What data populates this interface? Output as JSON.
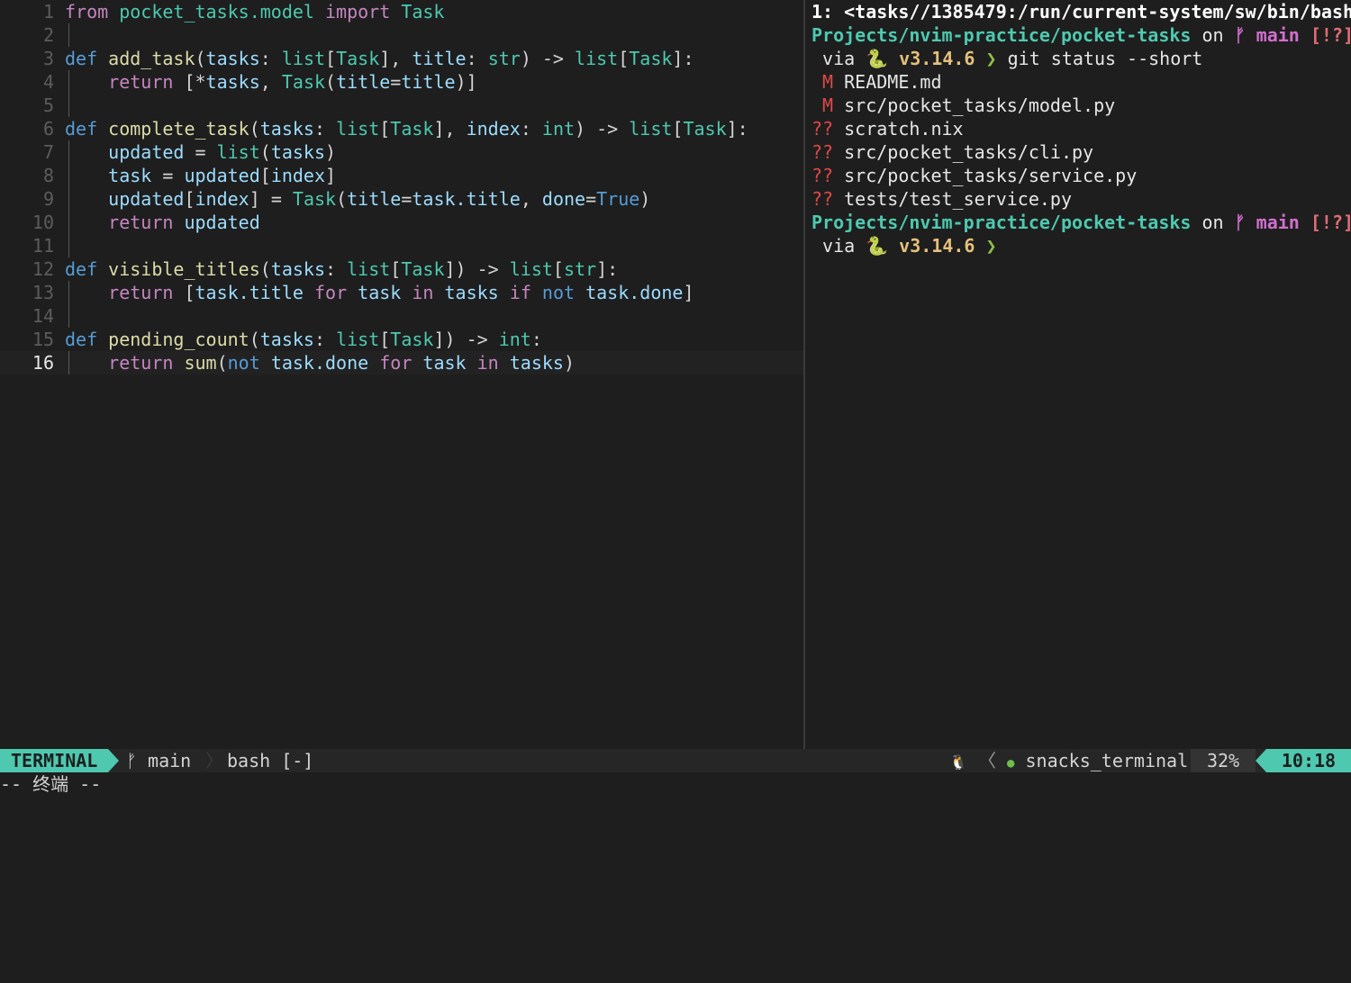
{
  "editor": {
    "lines": [
      {
        "num": "1",
        "tokens": [
          [
            "kw",
            "from"
          ],
          [
            "op",
            " "
          ],
          [
            "mod",
            "pocket_tasks.model"
          ],
          [
            "op",
            " "
          ],
          [
            "kw",
            "import"
          ],
          [
            "op",
            " "
          ],
          [
            "type",
            "Task"
          ]
        ]
      },
      {
        "num": "2",
        "tokens": []
      },
      {
        "num": "3",
        "tokens": [
          [
            "def",
            "def"
          ],
          [
            "op",
            " "
          ],
          [
            "fn",
            "add_task"
          ],
          [
            "punct",
            "("
          ],
          [
            "param",
            "tasks"
          ],
          [
            "punct",
            ": "
          ],
          [
            "type",
            "list"
          ],
          [
            "punct",
            "["
          ],
          [
            "type",
            "Task"
          ],
          [
            "punct",
            "], "
          ],
          [
            "param",
            "title"
          ],
          [
            "punct",
            ": "
          ],
          [
            "type",
            "str"
          ],
          [
            "punct",
            ") -> "
          ],
          [
            "type",
            "list"
          ],
          [
            "punct",
            "["
          ],
          [
            "type",
            "Task"
          ],
          [
            "punct",
            "]:"
          ]
        ]
      },
      {
        "num": "4",
        "tokens": [
          [
            "op",
            "    "
          ],
          [
            "kw",
            "return"
          ],
          [
            "punct",
            " [*"
          ],
          [
            "param",
            "tasks"
          ],
          [
            "punct",
            ", "
          ],
          [
            "type",
            "Task"
          ],
          [
            "punct",
            "("
          ],
          [
            "param",
            "title"
          ],
          [
            "punct",
            "="
          ],
          [
            "param",
            "title"
          ],
          [
            "punct",
            ")]"
          ]
        ]
      },
      {
        "num": "5",
        "tokens": []
      },
      {
        "num": "6",
        "tokens": [
          [
            "def",
            "def"
          ],
          [
            "op",
            " "
          ],
          [
            "fn",
            "complete_task"
          ],
          [
            "punct",
            "("
          ],
          [
            "param",
            "tasks"
          ],
          [
            "punct",
            ": "
          ],
          [
            "type",
            "list"
          ],
          [
            "punct",
            "["
          ],
          [
            "type",
            "Task"
          ],
          [
            "punct",
            "], "
          ],
          [
            "param",
            "index"
          ],
          [
            "punct",
            ": "
          ],
          [
            "type",
            "int"
          ],
          [
            "punct",
            ") -> "
          ],
          [
            "type",
            "list"
          ],
          [
            "punct",
            "["
          ],
          [
            "type",
            "Task"
          ],
          [
            "punct",
            "]:"
          ]
        ]
      },
      {
        "num": "7",
        "tokens": [
          [
            "op",
            "    "
          ],
          [
            "param",
            "updated"
          ],
          [
            "punct",
            " = "
          ],
          [
            "type",
            "list"
          ],
          [
            "punct",
            "("
          ],
          [
            "param",
            "tasks"
          ],
          [
            "punct",
            ")"
          ]
        ]
      },
      {
        "num": "8",
        "tokens": [
          [
            "op",
            "    "
          ],
          [
            "param",
            "task"
          ],
          [
            "punct",
            " = "
          ],
          [
            "param",
            "updated"
          ],
          [
            "punct",
            "["
          ],
          [
            "param",
            "index"
          ],
          [
            "punct",
            "]"
          ]
        ]
      },
      {
        "num": "9",
        "tokens": [
          [
            "op",
            "    "
          ],
          [
            "param",
            "updated"
          ],
          [
            "punct",
            "["
          ],
          [
            "param",
            "index"
          ],
          [
            "punct",
            "] = "
          ],
          [
            "type",
            "Task"
          ],
          [
            "punct",
            "("
          ],
          [
            "param",
            "title"
          ],
          [
            "punct",
            "="
          ],
          [
            "param",
            "task.title"
          ],
          [
            "punct",
            ", "
          ],
          [
            "param",
            "done"
          ],
          [
            "punct",
            "="
          ],
          [
            "const",
            "True"
          ],
          [
            "punct",
            ")"
          ]
        ]
      },
      {
        "num": "10",
        "tokens": [
          [
            "op",
            "    "
          ],
          [
            "kw",
            "return"
          ],
          [
            "op",
            " "
          ],
          [
            "param",
            "updated"
          ]
        ]
      },
      {
        "num": "11",
        "tokens": []
      },
      {
        "num": "12",
        "tokens": [
          [
            "def",
            "def"
          ],
          [
            "op",
            " "
          ],
          [
            "fn",
            "visible_titles"
          ],
          [
            "punct",
            "("
          ],
          [
            "param",
            "tasks"
          ],
          [
            "punct",
            ": "
          ],
          [
            "type",
            "list"
          ],
          [
            "punct",
            "["
          ],
          [
            "type",
            "Task"
          ],
          [
            "punct",
            "]) -> "
          ],
          [
            "type",
            "list"
          ],
          [
            "punct",
            "["
          ],
          [
            "type",
            "str"
          ],
          [
            "punct",
            "]:"
          ]
        ]
      },
      {
        "num": "13",
        "tokens": [
          [
            "op",
            "    "
          ],
          [
            "kw",
            "return"
          ],
          [
            "punct",
            " ["
          ],
          [
            "param",
            "task.title"
          ],
          [
            "op",
            " "
          ],
          [
            "kw",
            "for"
          ],
          [
            "op",
            " "
          ],
          [
            "param",
            "task"
          ],
          [
            "op",
            " "
          ],
          [
            "kw",
            "in"
          ],
          [
            "op",
            " "
          ],
          [
            "param",
            "tasks"
          ],
          [
            "op",
            " "
          ],
          [
            "kw",
            "if"
          ],
          [
            "op",
            " "
          ],
          [
            "def",
            "not"
          ],
          [
            "op",
            " "
          ],
          [
            "param",
            "task.done"
          ],
          [
            "punct",
            "]"
          ]
        ]
      },
      {
        "num": "14",
        "tokens": []
      },
      {
        "num": "15",
        "tokens": [
          [
            "def",
            "def"
          ],
          [
            "op",
            " "
          ],
          [
            "fn",
            "pending_count"
          ],
          [
            "punct",
            "("
          ],
          [
            "param",
            "tasks"
          ],
          [
            "punct",
            ": "
          ],
          [
            "type",
            "list"
          ],
          [
            "punct",
            "["
          ],
          [
            "type",
            "Task"
          ],
          [
            "punct",
            "]) -> "
          ],
          [
            "type",
            "int"
          ],
          [
            "punct",
            ":"
          ]
        ]
      },
      {
        "num": "16",
        "tokens": [
          [
            "op",
            "    "
          ],
          [
            "kw",
            "return"
          ],
          [
            "op",
            " "
          ],
          [
            "builtin",
            "sum"
          ],
          [
            "punct",
            "("
          ],
          [
            "def",
            "not"
          ],
          [
            "op",
            " "
          ],
          [
            "param",
            "task.done"
          ],
          [
            "op",
            " "
          ],
          [
            "kw",
            "for"
          ],
          [
            "op",
            " "
          ],
          [
            "param",
            "task"
          ],
          [
            "op",
            " "
          ],
          [
            "kw",
            "in"
          ],
          [
            "op",
            " "
          ],
          [
            "param",
            "tasks"
          ],
          [
            "punct",
            ")"
          ]
        ]
      }
    ]
  },
  "terminal": {
    "header": "1: <tasks//1385479:/run/current-system/sw/bin/bash",
    "prompt_path": "Projects/nvim-practice/pocket-tasks",
    "prompt_on": " on ",
    "branch_icon": "ᚠ",
    "branch": "main",
    "git_flags": "[!?]",
    "via": " via ",
    "python_icon": "🐍",
    "python_version": "v3.14.6",
    "prompt_char": "❯",
    "command": "git status --short",
    "status_lines": [
      {
        "flag": " M",
        "file": "README.md"
      },
      {
        "flag": " M",
        "file": "src/pocket_tasks/model.py"
      },
      {
        "flag": "??",
        "file": "scratch.nix"
      },
      {
        "flag": "??",
        "file": "src/pocket_tasks/cli.py"
      },
      {
        "flag": "??",
        "file": "src/pocket_tasks/service.py"
      },
      {
        "flag": "??",
        "file": "tests/test_service.py"
      }
    ]
  },
  "statusbar": {
    "mode": "TERMINAL",
    "branch_icon": "ᚠ",
    "branch": "main",
    "sep": "〉",
    "file": "bash [-]",
    "os_icon": "🐧",
    "lsp_sep": "〈",
    "leaf_icon": "●",
    "filetype": "snacks_terminal",
    "percent": "32%",
    "time": "10:18"
  },
  "cmdline": "-- 终端 --",
  "colors": {
    "accent": "#4ec9b0",
    "background": "#1e1e1e",
    "keyword": "#c586c0",
    "def": "#569cd6",
    "function": "#dcdcaa",
    "param": "#9cdcfe"
  }
}
